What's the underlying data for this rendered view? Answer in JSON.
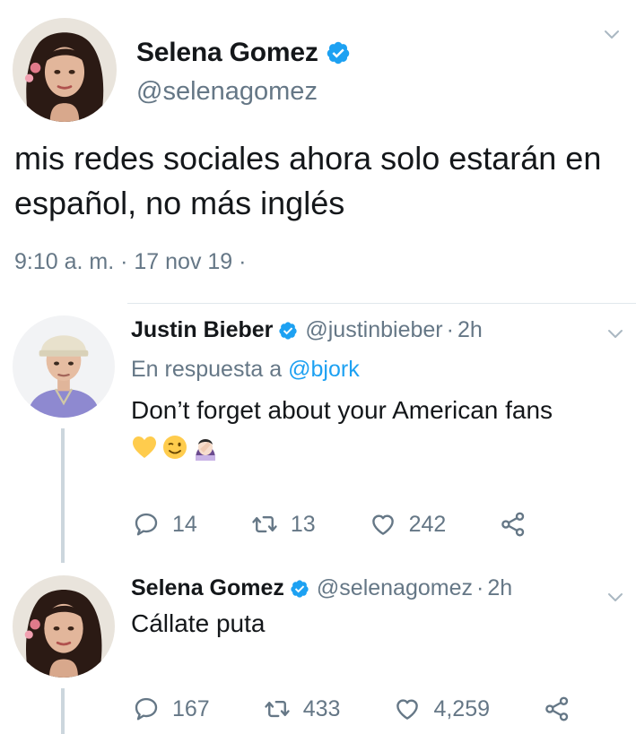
{
  "main_tweet": {
    "name": "Selena Gomez",
    "handle": "@selenagomez",
    "text": "mis redes sociales ahora solo estarán en español, no más inglés",
    "timestamp": "9:10 a. m. · 17 nov 19 ·"
  },
  "replies": [
    {
      "name": "Justin Bieber",
      "handle": "@justinbieber",
      "separator": "·",
      "age": "2h",
      "in_reply_prefix": "En respuesta a ",
      "in_reply_mention": "@bjork",
      "text": "Don’t forget about your American fans",
      "emojis": [
        "yellow-heart-emoji",
        "winking-face-emoji",
        "woman-facepalming-emoji"
      ],
      "stats": {
        "replies": "14",
        "retweets": "13",
        "likes": "242"
      }
    },
    {
      "name": "Selena Gomez",
      "handle": "@selenagomez",
      "separator": "·",
      "age": "2h",
      "text": "Cállate puta",
      "stats": {
        "replies": "167",
        "retweets": "433",
        "likes": "4,259"
      }
    }
  ],
  "colors": {
    "verified": "#1da1f2",
    "secondary_text": "#657786",
    "mention": "#1da1f2",
    "thread_line": "#ccd6dd"
  },
  "icons": [
    "chevron-down-icon",
    "verified-badge-icon",
    "reply-icon",
    "retweet-icon",
    "like-icon",
    "share-icon"
  ]
}
